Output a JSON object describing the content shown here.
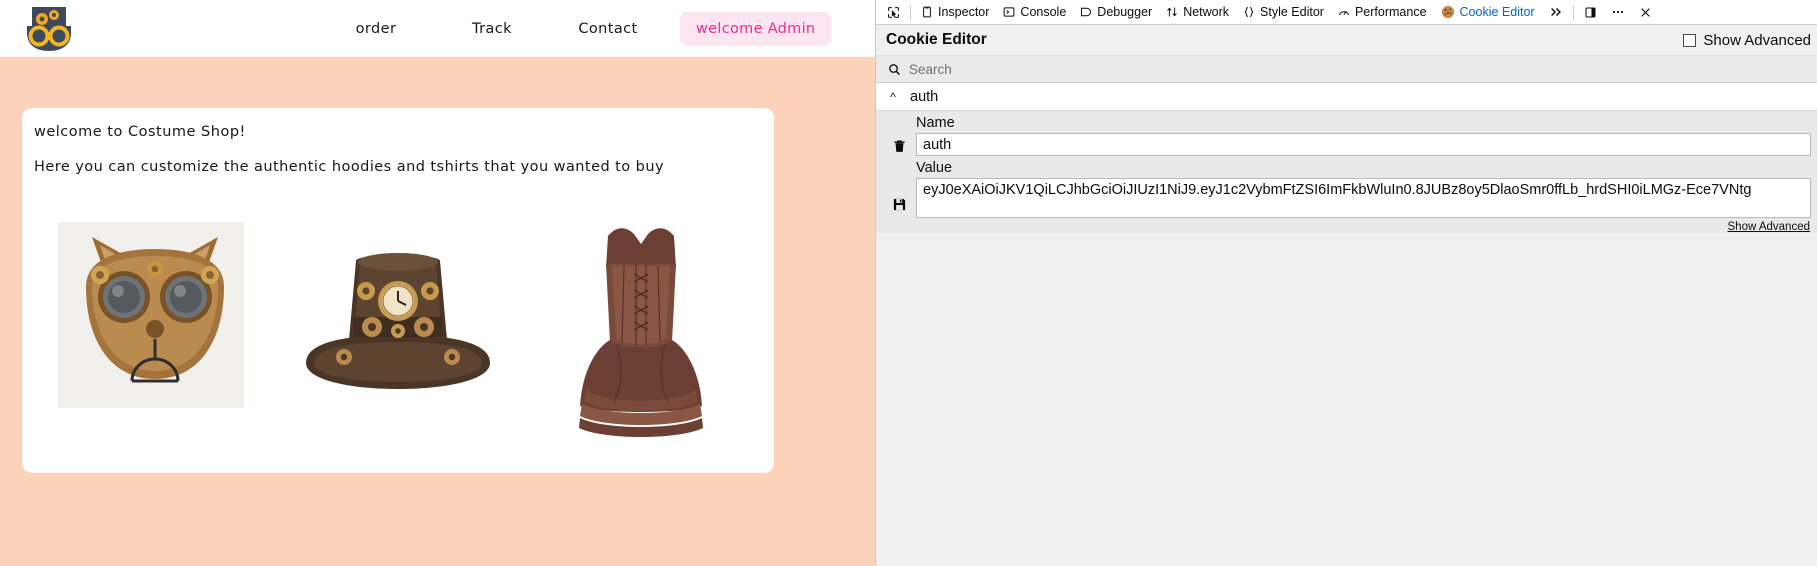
{
  "webpage": {
    "logo_icon": "steampunk-goggles-logo",
    "nav": [
      {
        "label": "order"
      },
      {
        "label": "Track"
      },
      {
        "label": "Contact"
      }
    ],
    "welcome_badge": "welcome Admin",
    "card": {
      "title": "welcome to Costume Shop!",
      "subtitle": "Here you can customize the authentic hoodies and tshirts that you wanted to buy"
    },
    "products": [
      {
        "name": "steampunk-cat-mask"
      },
      {
        "name": "steampunk-top-hat"
      },
      {
        "name": "steampunk-corset-dress"
      }
    ],
    "colors": {
      "body_bg": "#FCD2BA",
      "badge_bg": "#FCE4F1",
      "badge_text": "#ED2E8E"
    }
  },
  "devtools": {
    "tabs": [
      {
        "label": "Inspector",
        "icon": "inspector-icon",
        "active": false
      },
      {
        "label": "Console",
        "icon": "console-icon",
        "active": false
      },
      {
        "label": "Debugger",
        "icon": "debugger-icon",
        "active": false
      },
      {
        "label": "Network",
        "icon": "network-icon",
        "active": false
      },
      {
        "label": "Style Editor",
        "icon": "style-editor-icon",
        "active": false
      },
      {
        "label": "Performance",
        "icon": "performance-icon",
        "active": false
      },
      {
        "label": "Cookie Editor",
        "icon": "cookie-icon",
        "active": true
      }
    ],
    "overflow_icon": "chevron-double-right-icon",
    "dock_icon": "dock-panel-icon",
    "meatball_icon": "more-options-icon",
    "close_icon": "close-icon",
    "panel": {
      "title": "Cookie Editor",
      "show_advanced_checkbox": "Show Advanced",
      "search_placeholder": "Search",
      "search_icon": "search-icon",
      "cookie_entry": {
        "name": "auth",
        "expand_icon": "chevron-up-icon",
        "delete_icon": "trash-icon",
        "save_icon": "save-icon",
        "fields": {
          "name_label": "Name",
          "name_value": "auth",
          "value_label": "Value",
          "value_value": "eyJ0eXAiOiJKV1QiLCJhbGciOiJIUzI1NiJ9.eyJ1c2VybmFtZSI6ImFkbWluIn0.8JUBz8oy5DlaoSmr0ffLb_hrdSHI0iLMGz-Ece7VNtg"
        },
        "show_advanced_link": "Show Advanced"
      }
    },
    "colors": {
      "active_tab": "#0a62c7",
      "panel_bg": "#f0f0f0"
    }
  }
}
